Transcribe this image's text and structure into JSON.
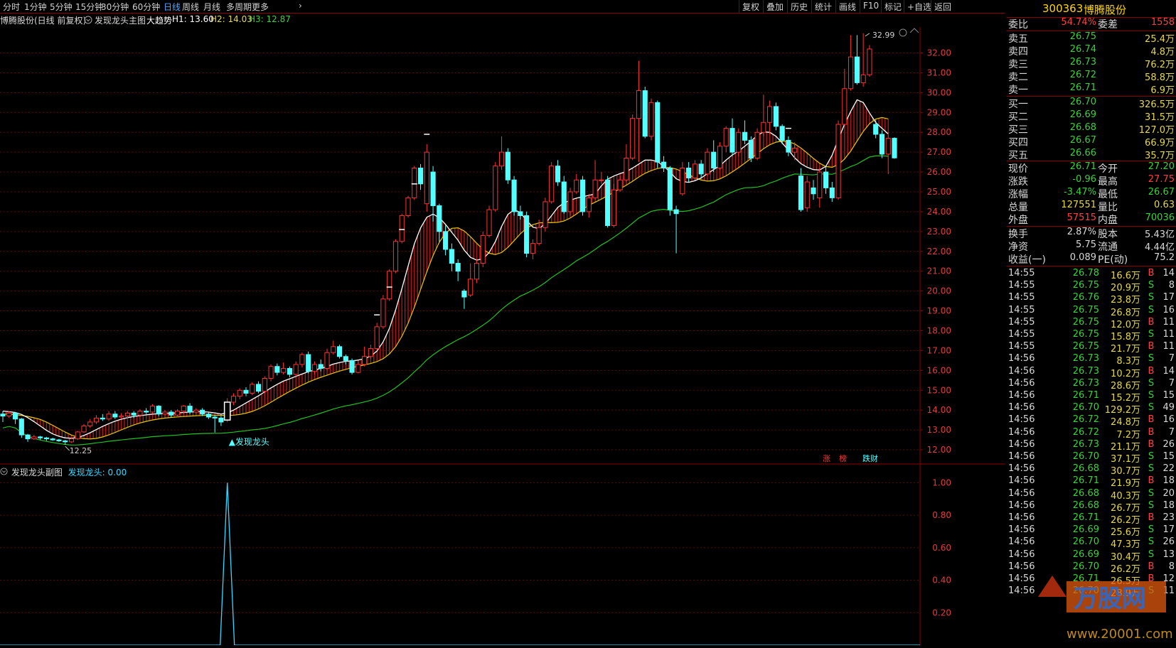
{
  "periods": [
    {
      "label": "分时",
      "active": false
    },
    {
      "label": "1分钟",
      "active": false
    },
    {
      "label": "5分钟",
      "active": false
    },
    {
      "label": "15分钟",
      "active": false
    },
    {
      "label": "30分钟",
      "active": false
    },
    {
      "label": "60分钟",
      "active": false
    },
    {
      "label": "日线",
      "active": true
    },
    {
      "label": "周线",
      "active": false
    },
    {
      "label": "月线",
      "active": false
    },
    {
      "label": "多周期",
      "active": false
    },
    {
      "label": "更多",
      "active": false
    }
  ],
  "tools": [
    "复权",
    "叠加",
    "历史",
    "统计",
    "画线",
    "F10",
    "标记",
    "+自选",
    "返回"
  ],
  "infoline": {
    "stock": "博腾股份(日线 前复权)",
    "indicator": "发现龙头主图",
    "trend_label": "大趋势",
    "h1": "H1: 13.60",
    "h2": "H2: 14.03",
    "h3": "H3: 12.87"
  },
  "sub_header": {
    "name": "发现龙头副图",
    "series": "发现龙头: 0.00"
  },
  "annotations": {
    "signal": "▲发现龙头",
    "high": "32.99",
    "low": "12.25",
    "zhang": "涨",
    "chang": "榜",
    "diecai": "跌财"
  },
  "chart_data": {
    "type": "candlestick",
    "y_ticks": [
      "32.00",
      "31.00",
      "30.00",
      "29.00",
      "28.00",
      "27.00",
      "26.00",
      "25.00",
      "24.00",
      "23.00",
      "22.00",
      "21.00",
      "20.00",
      "19.00",
      "18.00",
      "17.00",
      "16.00",
      "15.00",
      "14.00",
      "13.00",
      "12.00"
    ],
    "sub_y_ticks": [
      "1.00",
      "0.80",
      "0.60",
      "0.40",
      "0.20"
    ],
    "ylim": [
      11.5,
      33.2
    ],
    "sub_ylim": [
      0,
      1.05
    ],
    "candles": [
      [
        13.8,
        13.7,
        13.95,
        13.4
      ],
      [
        13.7,
        13.85,
        13.95,
        13.6
      ],
      [
        13.85,
        13.55,
        13.9,
        13.3
      ],
      [
        13.55,
        12.75,
        13.6,
        12.6
      ],
      [
        12.75,
        12.55,
        12.8,
        12.4
      ],
      [
        12.55,
        12.65,
        12.75,
        12.5
      ],
      [
        12.65,
        12.6,
        12.7,
        12.5
      ],
      [
        12.6,
        12.55,
        12.65,
        12.45
      ],
      [
        12.55,
        12.5,
        12.6,
        12.45
      ],
      [
        12.5,
        12.45,
        12.55,
        12.4
      ],
      [
        12.45,
        12.4,
        12.5,
        12.25
      ],
      [
        12.4,
        12.55,
        12.6,
        12.35
      ],
      [
        12.55,
        12.9,
        12.95,
        12.5
      ],
      [
        12.9,
        13.2,
        13.3,
        12.85
      ],
      [
        13.2,
        13.4,
        13.55,
        13.1
      ],
      [
        13.4,
        13.6,
        13.75,
        13.3
      ],
      [
        13.6,
        13.55,
        13.8,
        13.45
      ],
      [
        13.55,
        13.8,
        13.95,
        13.45
      ],
      [
        13.8,
        13.65,
        13.95,
        13.55
      ],
      [
        13.65,
        13.7,
        13.85,
        13.55
      ],
      [
        13.7,
        13.85,
        13.95,
        13.6
      ],
      [
        13.85,
        13.75,
        13.95,
        13.6
      ],
      [
        13.75,
        13.95,
        14.05,
        13.65
      ],
      [
        13.95,
        13.9,
        14.1,
        13.8
      ],
      [
        13.9,
        14.2,
        14.3,
        13.8
      ],
      [
        14.2,
        13.8,
        14.25,
        13.7
      ],
      [
        13.8,
        13.9,
        14.0,
        13.7
      ],
      [
        13.9,
        13.75,
        14.0,
        13.65
      ],
      [
        13.75,
        13.95,
        14.05,
        13.65
      ],
      [
        13.95,
        14.2,
        14.25,
        13.8
      ],
      [
        14.2,
        13.9,
        14.35,
        13.8
      ],
      [
        13.9,
        14.0,
        14.1,
        13.8
      ],
      [
        14.0,
        13.8,
        14.1,
        13.7
      ],
      [
        13.8,
        13.65,
        13.9,
        13.55
      ],
      [
        13.65,
        13.6,
        13.75,
        12.87
      ],
      [
        13.6,
        13.4,
        13.7,
        13.2
      ],
      [
        13.5,
        14.4,
        14.6,
        13.4
      ],
      [
        14.4,
        14.7,
        14.85,
        14.25
      ],
      [
        14.7,
        15.0,
        15.1,
        14.55
      ],
      [
        15.0,
        14.85,
        15.15,
        14.7
      ],
      [
        14.85,
        15.3,
        15.4,
        14.75
      ],
      [
        15.3,
        14.95,
        15.45,
        14.85
      ],
      [
        14.95,
        15.6,
        15.7,
        14.85
      ],
      [
        15.6,
        16.2,
        16.3,
        15.45
      ],
      [
        16.2,
        15.9,
        16.35,
        15.75
      ],
      [
        15.9,
        16.1,
        16.4,
        15.8
      ],
      [
        16.1,
        15.8,
        16.2,
        15.65
      ],
      [
        15.8,
        16.3,
        16.45,
        15.7
      ],
      [
        16.3,
        16.8,
        16.9,
        16.15
      ],
      [
        16.8,
        15.95,
        16.95,
        15.85
      ],
      [
        15.95,
        16.3,
        16.45,
        15.8
      ],
      [
        16.3,
        16.1,
        16.55,
        15.95
      ],
      [
        16.1,
        16.9,
        17.1,
        16.0
      ],
      [
        16.9,
        17.2,
        17.5,
        16.8
      ],
      [
        17.2,
        16.7,
        17.3,
        16.6
      ],
      [
        16.7,
        16.5,
        16.8,
        16.3
      ],
      [
        16.5,
        15.9,
        16.6,
        15.8
      ],
      [
        15.9,
        16.3,
        16.5,
        15.85
      ],
      [
        16.3,
        16.7,
        17.2,
        16.2
      ],
      [
        16.7,
        17.1,
        17.3,
        16.6
      ],
      [
        17.1,
        18.2,
        18.4,
        17.0
      ],
      [
        18.2,
        19.6,
        19.8,
        18.1
      ],
      [
        19.6,
        21.0,
        21.1,
        19.5
      ],
      [
        21.0,
        22.5,
        22.6,
        20.9
      ],
      [
        22.5,
        23.8,
        23.9,
        22.4
      ],
      [
        23.8,
        24.7,
        24.8,
        23.7
      ],
      [
        24.7,
        26.2,
        26.3,
        24.6
      ],
      [
        26.2,
        25.4,
        26.4,
        25.1
      ],
      [
        24.4,
        27.0,
        27.4,
        24.0
      ],
      [
        26.0,
        24.3,
        26.3,
        23.5
      ],
      [
        24.3,
        23.0,
        24.4,
        22.5
      ],
      [
        23.0,
        22.1,
        23.3,
        21.8
      ],
      [
        22.1,
        21.4,
        22.4,
        21.0
      ],
      [
        21.4,
        21.0,
        21.6,
        20.5
      ],
      [
        20.0,
        19.7,
        20.1,
        19.1
      ],
      [
        19.8,
        20.6,
        21.4,
        19.7
      ],
      [
        20.6,
        21.4,
        21.6,
        20.4
      ],
      [
        21.4,
        22.8,
        23.0,
        21.2
      ],
      [
        22.8,
        24.1,
        24.3,
        22.7
      ],
      [
        24.1,
        26.3,
        26.5,
        24.0
      ],
      [
        26.3,
        27.0,
        27.8,
        26.1
      ],
      [
        27.0,
        25.6,
        27.2,
        25.4
      ],
      [
        25.6,
        24.0,
        25.8,
        23.8
      ],
      [
        24.0,
        23.8,
        24.3,
        23.6
      ],
      [
        23.8,
        21.9,
        24.0,
        21.7
      ],
      [
        21.9,
        22.4,
        22.6,
        21.6
      ],
      [
        22.4,
        23.2,
        23.6,
        22.3
      ],
      [
        23.2,
        24.5,
        24.7,
        23.0
      ],
      [
        24.5,
        26.3,
        26.5,
        24.4
      ],
      [
        26.3,
        25.5,
        26.6,
        25.3
      ],
      [
        25.5,
        24.0,
        25.8,
        23.9
      ],
      [
        24.0,
        25.0,
        25.2,
        23.8
      ],
      [
        25.0,
        25.6,
        25.9,
        24.9
      ],
      [
        25.6,
        24.0,
        25.8,
        23.8
      ],
      [
        24.0,
        24.7,
        24.9,
        23.7
      ],
      [
        24.7,
        25.6,
        26.6,
        24.6
      ],
      [
        25.6,
        25.6,
        26.0,
        25.4
      ],
      [
        25.6,
        23.3,
        25.8,
        23.2
      ],
      [
        23.3,
        25.1,
        25.4,
        23.2
      ],
      [
        25.1,
        25.6,
        25.8,
        25.0
      ],
      [
        25.6,
        26.7,
        27.4,
        25.5
      ],
      [
        26.7,
        28.7,
        28.9,
        26.6
      ],
      [
        28.7,
        30.1,
        31.6,
        26.5
      ],
      [
        30.1,
        27.8,
        30.3,
        27.7
      ],
      [
        27.8,
        29.5,
        29.7,
        27.6
      ],
      [
        29.5,
        26.5,
        29.6,
        26.2
      ],
      [
        26.5,
        26.2,
        26.8,
        26.0
      ],
      [
        26.2,
        24.1,
        26.3,
        23.8
      ],
      [
        24.1,
        23.9,
        24.3,
        21.9
      ],
      [
        24.9,
        26.2,
        26.5,
        24.8
      ],
      [
        26.2,
        25.7,
        26.5,
        25.5
      ],
      [
        25.7,
        26.4,
        26.6,
        25.6
      ],
      [
        26.4,
        25.9,
        26.6,
        25.7
      ],
      [
        25.9,
        27.0,
        27.2,
        25.8
      ],
      [
        27.0,
        26.2,
        27.6,
        26.0
      ],
      [
        26.2,
        27.3,
        27.5,
        26.1
      ],
      [
        27.3,
        28.2,
        28.3,
        27.0
      ],
      [
        28.2,
        27.0,
        28.7,
        26.8
      ],
      [
        27.0,
        28.0,
        28.2,
        26.8
      ],
      [
        28.0,
        27.6,
        28.6,
        27.4
      ],
      [
        27.6,
        26.7,
        27.8,
        26.5
      ],
      [
        26.7,
        28.0,
        28.2,
        26.6
      ],
      [
        28.0,
        28.5,
        29.9,
        27.8
      ],
      [
        28.5,
        29.3,
        29.6,
        27.9
      ],
      [
        29.3,
        28.3,
        29.5,
        28.1
      ],
      [
        28.3,
        27.6,
        28.4,
        27.4
      ],
      [
        27.6,
        27.0,
        27.8,
        26.8
      ],
      [
        27.0,
        27.2,
        27.5,
        26.6
      ],
      [
        25.8,
        24.1,
        26.2,
        24.0
      ],
      [
        24.2,
        25.5,
        25.8,
        24.0
      ],
      [
        25.2,
        24.9,
        25.6,
        24.6
      ],
      [
        24.7,
        26.0,
        26.2,
        24.2
      ],
      [
        26.0,
        25.2,
        26.3,
        24.9
      ],
      [
        25.2,
        24.7,
        25.5,
        24.5
      ],
      [
        24.7,
        28.4,
        28.6,
        24.6
      ],
      [
        28.4,
        30.2,
        31.2,
        28.3
      ],
      [
        30.2,
        31.8,
        32.9,
        30.1
      ],
      [
        31.8,
        30.5,
        32.9,
        30.4
      ],
      [
        30.5,
        30.9,
        32.99,
        30.3
      ],
      [
        30.9,
        32.2,
        32.4,
        30.8
      ],
      [
        28.4,
        27.9,
        28.6,
        27.7
      ],
      [
        27.9,
        26.9,
        28.1,
        26.7
      ],
      [
        26.9,
        27.7,
        28.0,
        25.9
      ],
      [
        27.7,
        26.71,
        27.75,
        26.67
      ]
    ],
    "ma_white": [
      13.95,
      13.92,
      13.88,
      13.78,
      13.62,
      13.42,
      13.2,
      12.98,
      12.8,
      12.68,
      12.6,
      12.58,
      12.62,
      12.72,
      12.86,
      13.02,
      13.18,
      13.32,
      13.44,
      13.54,
      13.62,
      13.68,
      13.72,
      13.76,
      13.8,
      13.82,
      13.84,
      13.85,
      13.86,
      13.88,
      13.9,
      13.92,
      13.92,
      13.9,
      13.86,
      13.8,
      13.86,
      14.0,
      14.18,
      14.36,
      14.54,
      14.72,
      14.92,
      15.12,
      15.3,
      15.46,
      15.58,
      15.7,
      15.82,
      15.94,
      16.02,
      16.1,
      16.2,
      16.32,
      16.4,
      16.46,
      16.48,
      16.52,
      16.6,
      16.72,
      16.98,
      17.44,
      18.12,
      19.06,
      20.12,
      21.26,
      22.38,
      23.18,
      23.72,
      23.88,
      23.7,
      23.36,
      22.96,
      22.56,
      22.06,
      21.7,
      21.56,
      21.62,
      21.94,
      22.5,
      23.26,
      23.86,
      24.1,
      23.96,
      23.56,
      23.22,
      23.14,
      23.4,
      23.8,
      24.22,
      24.44,
      24.58,
      24.68,
      24.76,
      24.82,
      24.9,
      25.3,
      25.64,
      25.8,
      25.92,
      26.02,
      26.2,
      26.4,
      26.6,
      26.6,
      26.52,
      26.3,
      26.0,
      25.66,
      25.52,
      25.48,
      25.56,
      25.7,
      25.92,
      26.12,
      26.32,
      26.6,
      26.86,
      27.06,
      27.3,
      27.56,
      27.84,
      28.02,
      28.0,
      27.8,
      27.46,
      27.1,
      26.72,
      26.42,
      26.24,
      26.12,
      26.1,
      26.28,
      26.84,
      27.66,
      28.4,
      29.06,
      29.64,
      29.5,
      28.98,
      28.5,
      28.2,
      27.92
    ]
  }
}
